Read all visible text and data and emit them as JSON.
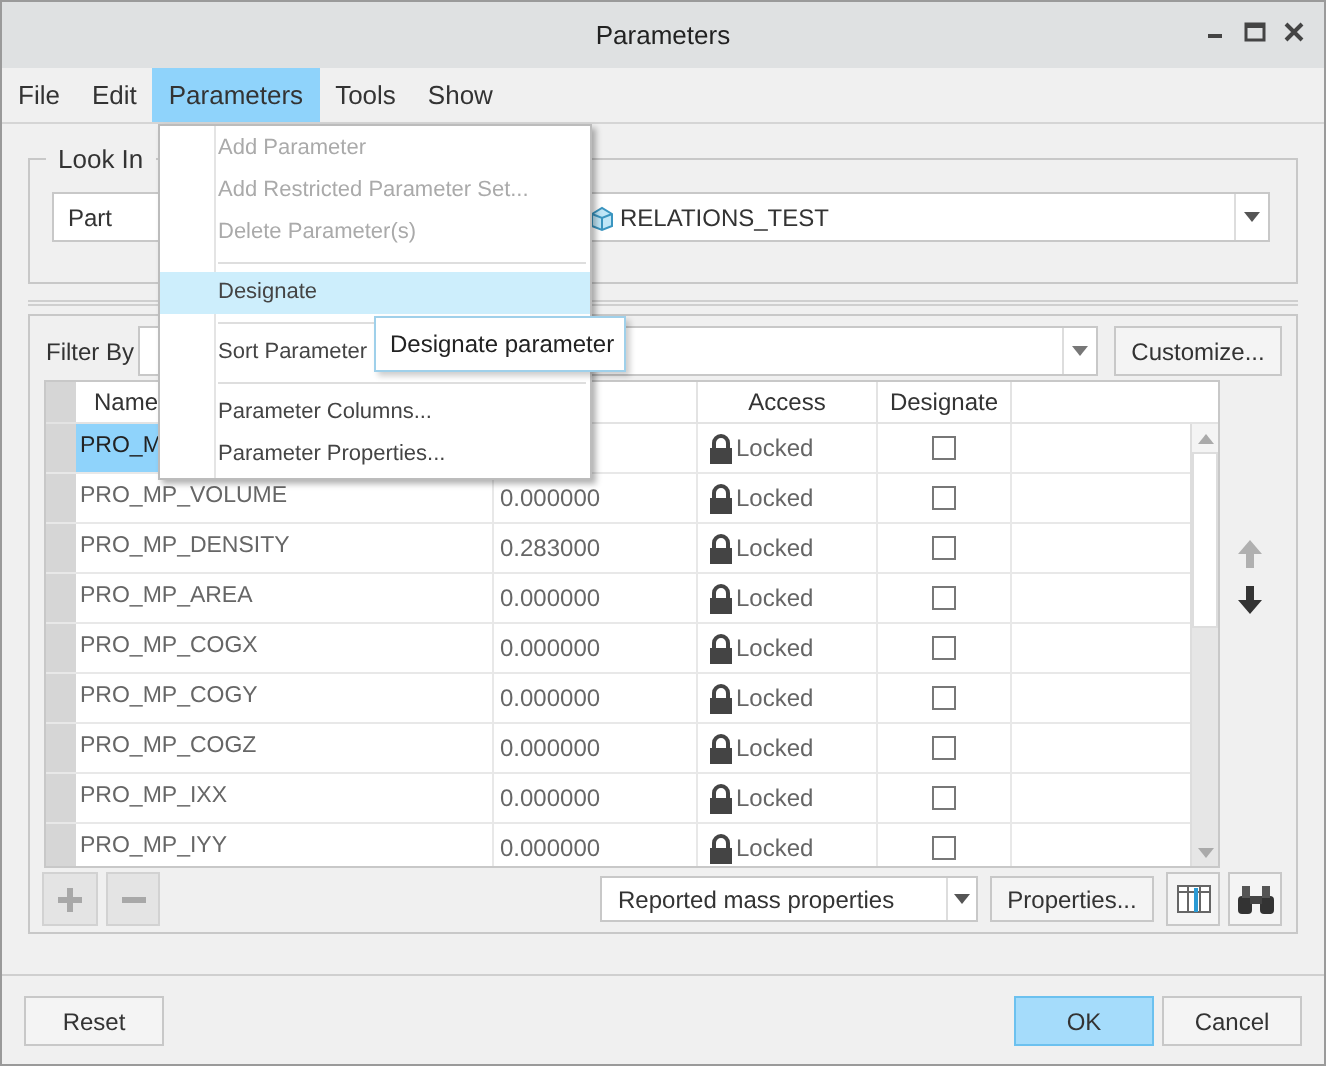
{
  "window": {
    "title": "Parameters"
  },
  "menu_bar": [
    {
      "label": "File",
      "selected": false
    },
    {
      "label": "Edit",
      "selected": false
    },
    {
      "label": "Parameters",
      "selected": true
    },
    {
      "label": "Tools",
      "selected": false
    },
    {
      "label": "Show",
      "selected": false
    }
  ],
  "menu": {
    "items": [
      {
        "kind": "item",
        "label": "Add Parameter",
        "disabled": true,
        "selected": false
      },
      {
        "kind": "item",
        "label": "Add Restricted Parameter Set...",
        "disabled": true,
        "selected": false
      },
      {
        "kind": "item",
        "label": "Delete Parameter(s)",
        "disabled": true,
        "selected": false
      },
      {
        "kind": "separator"
      },
      {
        "kind": "item",
        "label": "Designate",
        "disabled": false,
        "selected": true
      },
      {
        "kind": "separator"
      },
      {
        "kind": "item",
        "label": "Sort Parameter",
        "disabled": false,
        "selected": false
      },
      {
        "kind": "separator"
      },
      {
        "kind": "item",
        "label": "Parameter Columns...",
        "disabled": false,
        "selected": false
      },
      {
        "kind": "item",
        "label": "Parameter Properties...",
        "disabled": false,
        "selected": false
      }
    ]
  },
  "tooltip": "Designate parameter",
  "look_in": {
    "label": "Look In",
    "type": "Part",
    "object": "RELATIONS_TEST"
  },
  "filter": {
    "label": "Filter By",
    "customize_button": "Customize..."
  },
  "table": {
    "columns": [
      "Name",
      "Access",
      "Designate"
    ],
    "rows": [
      {
        "name": "PRO_M",
        "selected": true,
        "access": "Locked",
        "designated": false
      },
      {
        "name": "PRO_MP_VOLUME",
        "value": "0.000000",
        "selected": false,
        "access": "Locked",
        "designated": false
      },
      {
        "name": "PRO_MP_DENSITY",
        "value": "0.283000",
        "selected": false,
        "access": "Locked",
        "designated": false
      },
      {
        "name": "PRO_MP_AREA",
        "value": "0.000000",
        "selected": false,
        "access": "Locked",
        "designated": false
      },
      {
        "name": "PRO_MP_COGX",
        "value": "0.000000",
        "selected": false,
        "access": "Locked",
        "designated": false
      },
      {
        "name": "PRO_MP_COGY",
        "value": "0.000000",
        "selected": false,
        "access": "Locked",
        "designated": false
      },
      {
        "name": "PRO_MP_COGZ",
        "value": "0.000000",
        "selected": false,
        "access": "Locked",
        "designated": false
      },
      {
        "name": "PRO_MP_IXX",
        "value": "0.000000",
        "selected": false,
        "access": "Locked",
        "designated": false
      },
      {
        "name": "PRO_MP_IYY",
        "value": "0.000000",
        "selected": false,
        "access": "Locked",
        "designated": false
      }
    ]
  },
  "bottom_toolbar": {
    "set": "Reported mass properties",
    "properties_button": "Properties..."
  },
  "buttons": [
    {
      "label": "Reset",
      "kind": "left",
      "selected": false
    },
    {
      "label": "OK",
      "kind": "right",
      "selected": true
    },
    {
      "label": "Cancel",
      "kind": "right",
      "selected": false
    }
  ]
}
